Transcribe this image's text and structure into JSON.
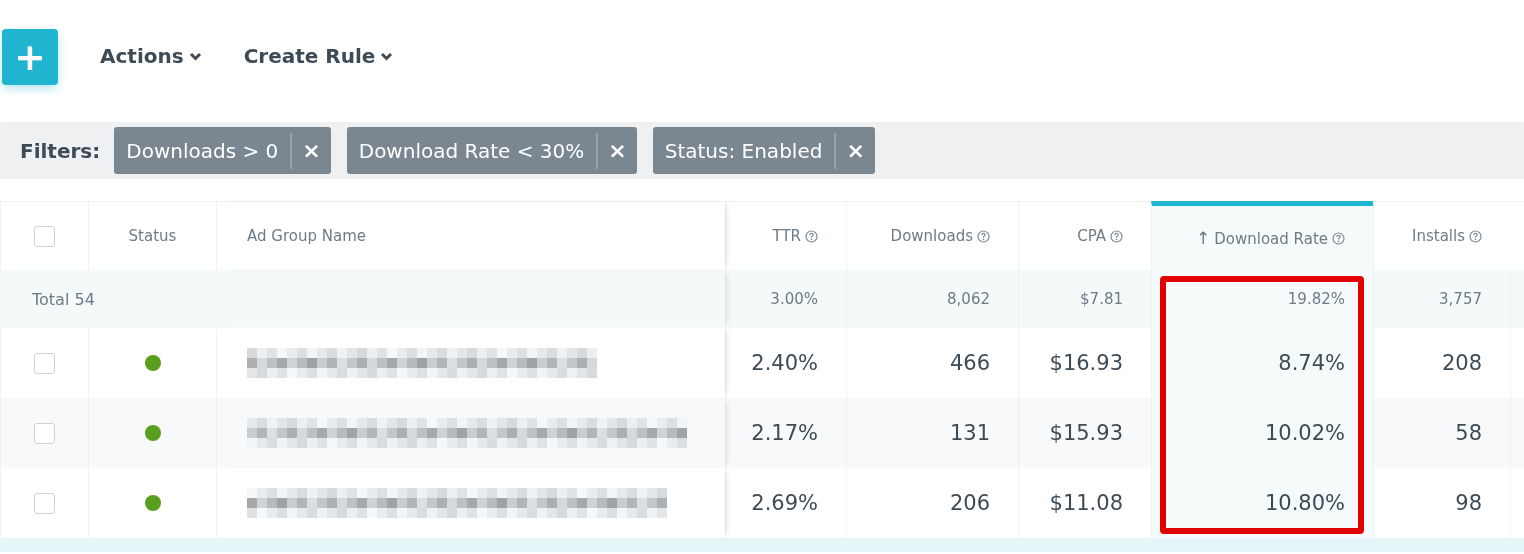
{
  "toolbar": {
    "add_button": "+",
    "menus": [
      {
        "label": "Actions"
      },
      {
        "label": "Create Rule"
      }
    ]
  },
  "filters": {
    "label": "Filters:",
    "chips": [
      {
        "label": "Downloads > 0",
        "remove": "×"
      },
      {
        "label": "Download Rate < 30%",
        "remove": "×"
      },
      {
        "label": "Status: Enabled",
        "remove": "×"
      }
    ]
  },
  "table": {
    "select_all_checked": false,
    "columns": [
      {
        "label": "Status",
        "help": false,
        "sorted": false
      },
      {
        "label": "Ad Group Name",
        "help": false,
        "sorted": false
      },
      {
        "label": "TTR",
        "help": true,
        "sorted": false
      },
      {
        "label": "Downloads",
        "help": true,
        "sorted": false
      },
      {
        "label": "CPA",
        "help": true,
        "sorted": false
      },
      {
        "label": "Download Rate",
        "help": true,
        "sorted": true,
        "sort_arrow": "↑",
        "highlighted": true
      },
      {
        "label": "Installs",
        "help": true,
        "sorted": false
      }
    ],
    "total": {
      "label": "Total 54",
      "values": [
        "3.00%",
        "8,062",
        "$7.81",
        "19.82%",
        "3,757"
      ]
    },
    "rows": [
      {
        "checked": false,
        "color": "#5a9e1e",
        "values": [
          "2.40%",
          "466",
          "$16.93",
          "8.74%",
          "208"
        ]
      },
      {
        "checked": false,
        "color": "#5a9e1e",
        "values": [
          "2.17%",
          "131",
          "$15.93",
          "10.02%",
          "58"
        ]
      },
      {
        "checked": false,
        "color": "#5a9e1e",
        "values": [
          "2.69%",
          "206",
          "$11.08",
          "10.80%",
          "98"
        ]
      }
    ]
  }
}
